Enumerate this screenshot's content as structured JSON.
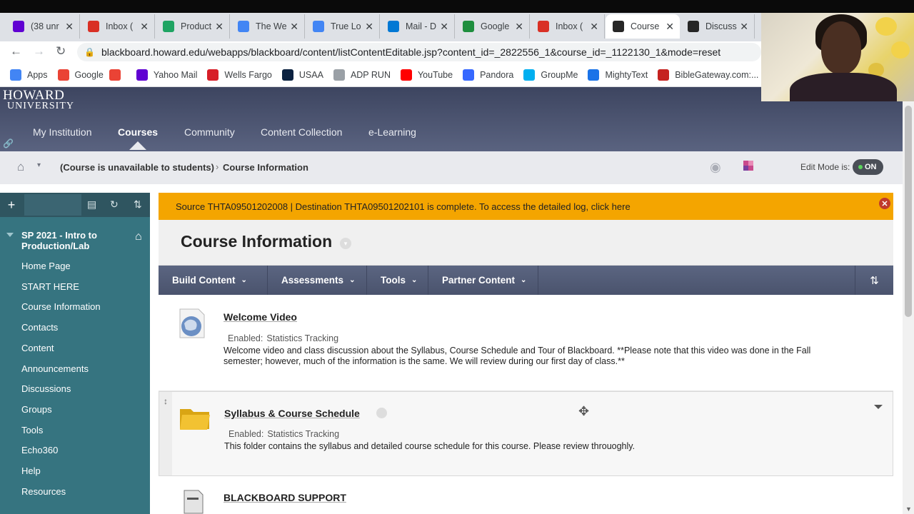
{
  "browser": {
    "tabs": [
      {
        "label": "(38 unr",
        "favicon": "yahoo-mail",
        "color": "#6001d2",
        "active": false
      },
      {
        "label": "Inbox (",
        "favicon": "gmail",
        "color": "#d93025",
        "active": false
      },
      {
        "label": "Product",
        "favicon": "google-drive",
        "color": "#1fa463",
        "active": false
      },
      {
        "label": "The We",
        "favicon": "google-docs",
        "color": "#4285f4",
        "active": false
      },
      {
        "label": "True Lo",
        "favicon": "google-docs",
        "color": "#4285f4",
        "active": false
      },
      {
        "label": "Mail - D",
        "favicon": "outlook",
        "color": "#0078d4",
        "active": false
      },
      {
        "label": "Google",
        "favicon": "google-classroom",
        "color": "#1e8e3e",
        "active": false
      },
      {
        "label": "Inbox (",
        "favicon": "gmail",
        "color": "#d93025",
        "active": false
      },
      {
        "label": "Course",
        "favicon": "blackboard",
        "color": "#262626",
        "active": true
      },
      {
        "label": "Discuss",
        "favicon": "blackboard",
        "color": "#262626",
        "active": false
      }
    ],
    "url": "blackboard.howard.edu/webapps/blackboard/content/listContentEditable.jsp?content_id=_2822556_1&course_id=_1122130_1&mode=reset",
    "bookmarks": [
      {
        "label": "Apps",
        "color": "#4285f4"
      },
      {
        "label": "Google",
        "color": "#ea4335"
      },
      {
        "label": "",
        "color": "#ea4335"
      },
      {
        "label": "Yahoo Mail",
        "color": "#6001d2"
      },
      {
        "label": "Wells Fargo",
        "color": "#d71e28"
      },
      {
        "label": "USAA",
        "color": "#0b2240"
      },
      {
        "label": "ADP RUN",
        "color": "#9aa0a6"
      },
      {
        "label": "YouTube",
        "color": "#ff0000"
      },
      {
        "label": "Pandora",
        "color": "#3668ff"
      },
      {
        "label": "GroupMe",
        "color": "#00aff0"
      },
      {
        "label": "MightyText",
        "color": "#1a73e8"
      },
      {
        "label": "BibleGateway.com:...",
        "color": "#c5221f"
      }
    ]
  },
  "header": {
    "logo_line1": "HOWARD",
    "logo_line2": "UNIVERSITY",
    "nav": [
      {
        "label": "My Institution",
        "active": false
      },
      {
        "label": "Courses",
        "active": true
      },
      {
        "label": "Community",
        "active": false
      },
      {
        "label": "Content Collection",
        "active": false
      },
      {
        "label": "e-Learning",
        "active": false
      }
    ]
  },
  "breadcrumb": {
    "course": "(Course is unavailable to students)",
    "separator": "›",
    "current": "Course Information",
    "edit_mode_label": "Edit Mode is:",
    "edit_mode_value": "ON"
  },
  "course_menu": {
    "title": "SP 2021 - Intro to Production/Lab",
    "items": [
      "Home Page",
      "START HERE",
      "Course Information",
      "Contacts",
      "Content",
      "Announcements",
      "Discussions",
      "Groups",
      "Tools",
      "Echo360",
      "Help",
      "Resources"
    ]
  },
  "alert": {
    "text": "Source THTA09501202008 | Destination THTA09501202101 is complete. To access the detailed log, click here"
  },
  "page": {
    "title": "Course Information",
    "actions": [
      "Build Content",
      "Assessments",
      "Tools",
      "Partner Content"
    ],
    "items": [
      {
        "title": "Welcome Video",
        "enabled_label": "Enabled:",
        "tracking": "Statistics Tracking",
        "description": "Welcome video and class discussion about the Syllabus, Course Schedule and Tour of Blackboard. **Please note that this video was done in the Fall semester; however, much of the information is the same. We will review during our first day of class.**",
        "icon": "globe-icon"
      },
      {
        "title": "Syllabus & Course Schedule",
        "enabled_label": "Enabled:",
        "tracking": "Statistics Tracking",
        "description": "This folder contains the syllabus and detailed course schedule for this course.  Please review throuoghly.",
        "icon": "folder-icon"
      },
      {
        "title": "BLACKBOARD SUPPORT",
        "icon": "document-icon"
      }
    ]
  },
  "colors": {
    "header": "#4b5370",
    "course_menu": "#367480",
    "alert": "#f4a500",
    "action_bar": "#515a76"
  }
}
